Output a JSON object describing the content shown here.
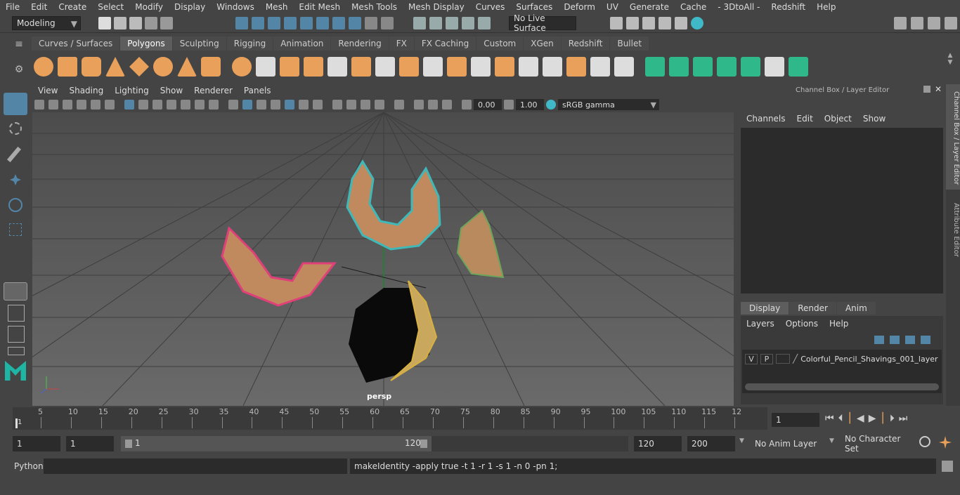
{
  "menu": [
    "File",
    "Edit",
    "Create",
    "Select",
    "Modify",
    "Display",
    "Windows",
    "Mesh",
    "Edit Mesh",
    "Mesh Tools",
    "Mesh Display",
    "Curves",
    "Surfaces",
    "Deform",
    "UV",
    "Generate",
    "Cache",
    "- 3DtoAll -",
    "Redshift",
    "Help"
  ],
  "toolbar": {
    "mode": "Modeling",
    "live_surface": "No Live Surface"
  },
  "shelf_tabs": [
    "Curves / Surfaces",
    "Polygons",
    "Sculpting",
    "Rigging",
    "Animation",
    "Rendering",
    "FX",
    "FX Caching",
    "Custom",
    "XGen",
    "Redshift",
    "Bullet"
  ],
  "active_shelf_tab": "Polygons",
  "viewport": {
    "menu": [
      "View",
      "Shading",
      "Lighting",
      "Show",
      "Renderer",
      "Panels"
    ],
    "near": "0.00",
    "far": "1.00",
    "color_space": "sRGB gamma",
    "camera_label": "persp"
  },
  "channel_box": {
    "title": "Channel Box / Layer Editor",
    "menu": [
      "Channels",
      "Edit",
      "Object",
      "Show"
    ],
    "layer_tabs": [
      "Display",
      "Render",
      "Anim"
    ],
    "active_layer_tab": "Display",
    "layer_menu": [
      "Layers",
      "Options",
      "Help"
    ],
    "layer": {
      "v": "V",
      "p": "P",
      "name": "Colorful_Pencil_Shavings_001_layer"
    }
  },
  "side_tabs": [
    "Channel Box / Layer Editor",
    "Attribute Editor"
  ],
  "timeline": {
    "ticks": [
      "5",
      "10",
      "15",
      "20",
      "25",
      "30",
      "35",
      "40",
      "45",
      "50",
      "55",
      "60",
      "65",
      "70",
      "75",
      "80",
      "85",
      "90",
      "95",
      "100",
      "105",
      "110",
      "115",
      "12"
    ],
    "start_label": "1",
    "current_frame": "1"
  },
  "range": {
    "start": "1",
    "start2": "1",
    "slider_start": "1",
    "slider_end": "120",
    "end": "120",
    "end2": "200",
    "anim_layer": "No Anim Layer",
    "char_set": "No Character Set"
  },
  "command": {
    "lang": "Python",
    "history": "makeIdentity -apply true -t 1 -r 1 -s 1 -n 0 -pn 1;"
  },
  "colors": {
    "accent": "#5285a6",
    "shelf_green": "#2fb88a",
    "shelf_orange": "#e8a05a",
    "pink": "#e0407a",
    "teal": "#3fb8b8"
  }
}
